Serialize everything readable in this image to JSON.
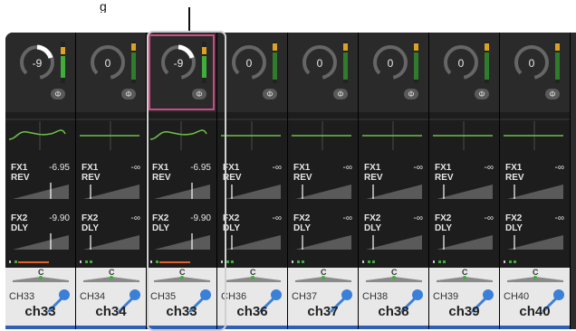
{
  "callout": {
    "label": "g"
  },
  "strips": [
    {
      "id": "CH33",
      "name": "ch33",
      "gain": "-9",
      "fx1_val": "-6.95",
      "fx2_val": "-9.90",
      "active": true
    },
    {
      "id": "CH34",
      "name": "ch34",
      "gain": "0",
      "fx1_val": "-∞",
      "fx2_val": "-∞",
      "active": false
    },
    {
      "id": "CH35",
      "name": "ch33",
      "gain": "-9",
      "fx1_val": "-6.95",
      "fx2_val": "-9.90",
      "active": true,
      "selected": true
    },
    {
      "id": "CH36",
      "name": "ch36",
      "gain": "0",
      "fx1_val": "-∞",
      "fx2_val": "-∞",
      "active": false
    },
    {
      "id": "CH37",
      "name": "ch37",
      "gain": "0",
      "fx1_val": "-∞",
      "fx2_val": "-∞",
      "active": false
    },
    {
      "id": "CH38",
      "name": "ch38",
      "gain": "0",
      "fx1_val": "-∞",
      "fx2_val": "-∞",
      "active": false
    },
    {
      "id": "CH39",
      "name": "ch39",
      "gain": "0",
      "fx1_val": "-∞",
      "fx2_val": "-∞",
      "active": false
    },
    {
      "id": "CH40",
      "name": "ch40",
      "gain": "0",
      "fx1_val": "-∞",
      "fx2_val": "-∞",
      "active": false
    }
  ],
  "labels": {
    "fx1": "FX1",
    "rev": "REV",
    "fx2": "FX2",
    "dly": "DLY",
    "pan_center": "C",
    "phase": "Φ"
  },
  "colors": {
    "accent_pink": "#d14a86",
    "eq_green": "#6fc24a",
    "mic_blue": "#3a7fd8",
    "channel_blue": "#2f5fb6"
  },
  "icons": {
    "mic": "microphone-icon",
    "phase": "phase-icon"
  }
}
